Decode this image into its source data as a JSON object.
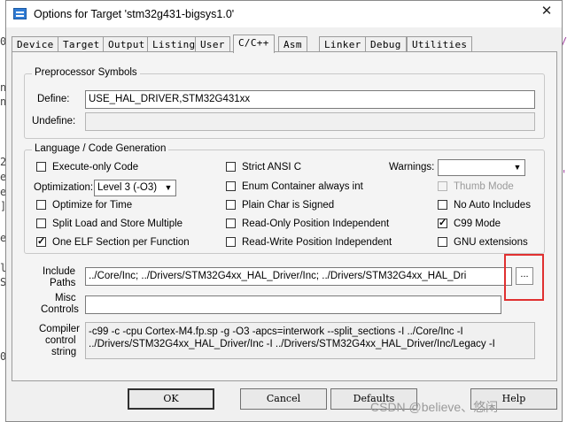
{
  "window": {
    "title": "Options for Target 'stm32g431-bigsys1.0'",
    "close_glyph": "✕"
  },
  "tabs": [
    {
      "label": "Device"
    },
    {
      "label": "Target"
    },
    {
      "label": "Output"
    },
    {
      "label": "Listing"
    },
    {
      "label": "User"
    },
    {
      "label": "C/C++"
    },
    {
      "label": "Asm"
    },
    {
      "label": "Linker"
    },
    {
      "label": "Debug"
    },
    {
      "label": "Utilities"
    }
  ],
  "active_tab": "C/C++",
  "preprocessor": {
    "legend": "Preprocessor Symbols",
    "define_label": "Define:",
    "define_value": "USE_HAL_DRIVER,STM32G431xx",
    "undefine_label": "Undefine:",
    "undefine_value": ""
  },
  "language": {
    "legend": "Language / Code Generation",
    "execute_only_code": {
      "label": "Execute-only Code",
      "checked": false
    },
    "optimization_label": "Optimization:",
    "optimization_value": "Level 3 (-O3)",
    "optimize_for_time": {
      "label": "Optimize for Time",
      "checked": false
    },
    "split_load_store": {
      "label": "Split Load and Store Multiple",
      "checked": false
    },
    "one_elf_section": {
      "label": "One ELF Section per Function",
      "checked": true
    },
    "strict_ansi_c": {
      "label": "Strict ANSI C",
      "checked": false
    },
    "enum_container": {
      "label": "Enum Container always int",
      "checked": false
    },
    "plain_char_signed": {
      "label": "Plain Char is Signed",
      "checked": false
    },
    "read_only_pi": {
      "label": "Read-Only Position Independent",
      "checked": false
    },
    "read_write_pi": {
      "label": "Read-Write Position Independent",
      "checked": false
    },
    "warnings_label": "Warnings:",
    "warnings_value": "",
    "thumb_mode": {
      "label": "Thumb Mode",
      "checked": false,
      "disabled": true
    },
    "no_auto_includes": {
      "label": "No Auto Includes",
      "checked": false
    },
    "c99_mode": {
      "label": "C99 Mode",
      "checked": true
    },
    "gnu_extensions": {
      "label": "GNU extensions",
      "checked": false
    }
  },
  "include_paths": {
    "label_line1": "Include",
    "label_line2": "Paths",
    "value": "../Core/Inc;             ../Drivers/STM32G4xx_HAL_Driver/Inc;             ../Drivers/STM32G4xx_HAL_Dri",
    "browse_label": "..."
  },
  "misc_controls": {
    "label_line1": "Misc",
    "label_line2": "Controls",
    "value": ""
  },
  "compiler_control": {
    "label_line1": "Compiler",
    "label_line2": "control",
    "label_line3": "string",
    "line1": "-c99 -c -cpu Cortex-M4.fp.sp -g -O3 -apcs=interwork --split_sections -I ../Core/Inc -I",
    "line2": "../Drivers/STM32G4xx_HAL_Driver/Inc -I ../Drivers/STM32G4xx_HAL_Driver/Inc/Legacy -I"
  },
  "buttons": {
    "ok": "OK",
    "cancel": "Cancel",
    "defaults": "Defaults",
    "help": "Help"
  },
  "watermark": "CSDN @believe、悠闲"
}
